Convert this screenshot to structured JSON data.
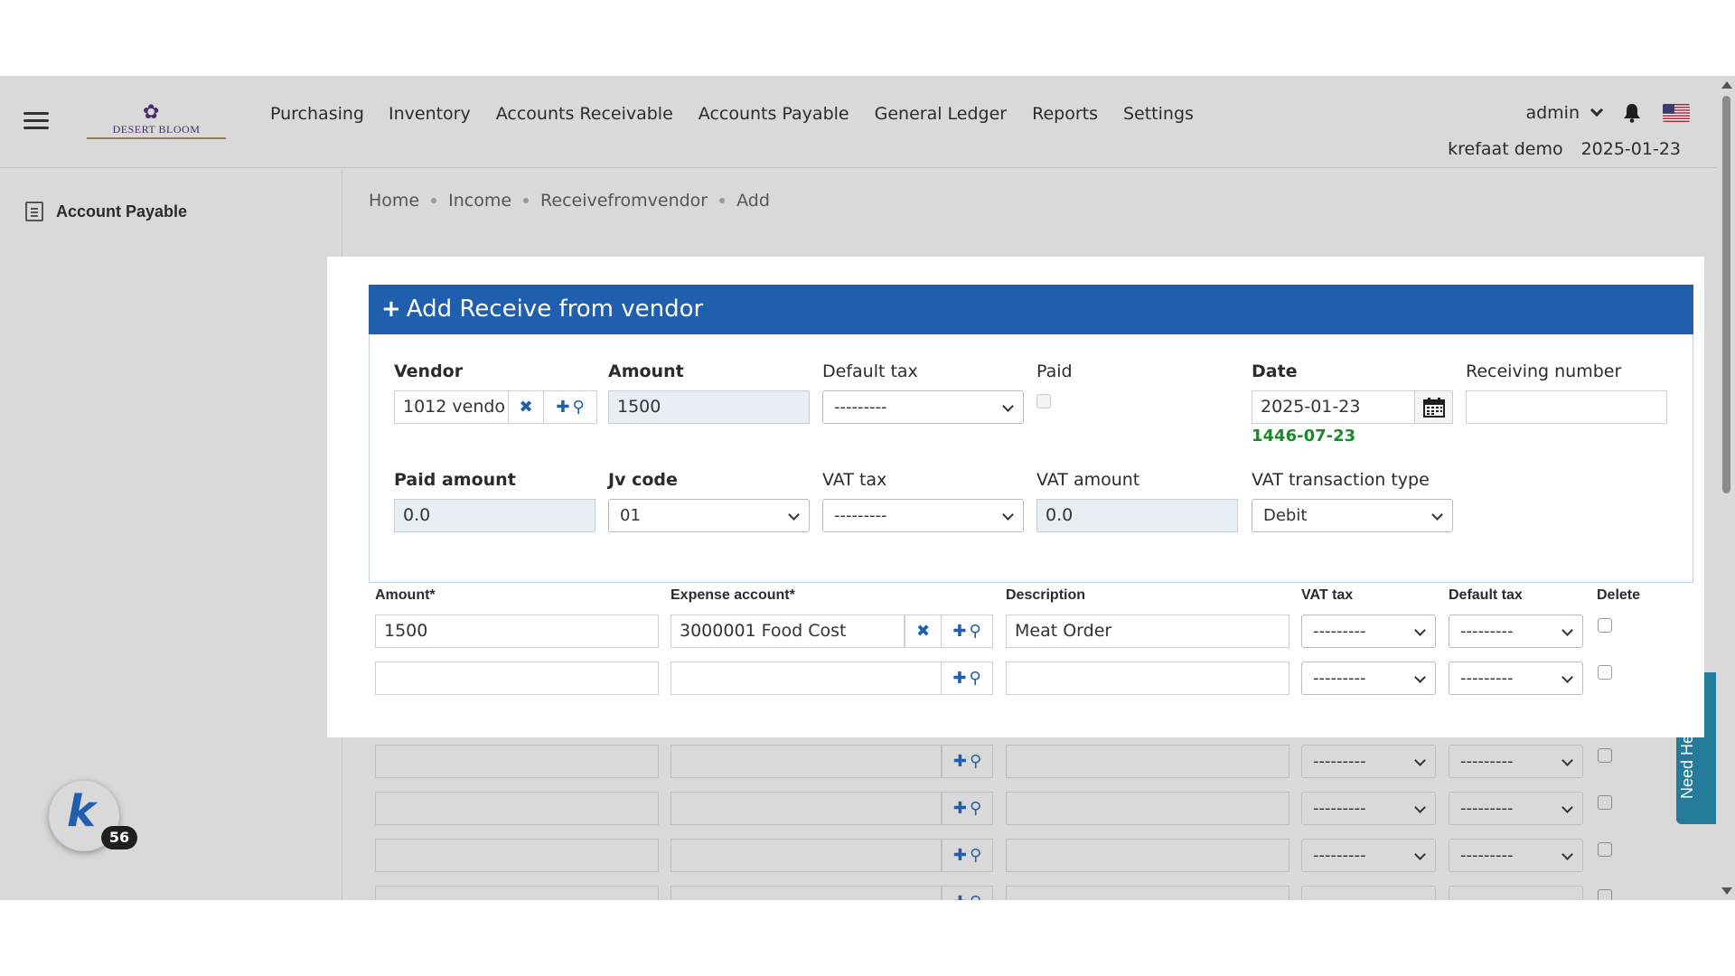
{
  "header": {
    "logo_text": "DESERT BLOOM",
    "nav": [
      "Purchasing",
      "Inventory",
      "Accounts Receivable",
      "Accounts Payable",
      "General Ledger",
      "Reports",
      "Settings"
    ],
    "user": "admin",
    "company": "krefaat demo",
    "date": "2025-01-23",
    "icons": {
      "menu": "hamburger-icon",
      "notifications": "bell-icon",
      "language": "us-flag-icon"
    }
  },
  "sidebar": {
    "items": [
      {
        "label": "Account Payable",
        "icon": "clipboard-icon"
      }
    ]
  },
  "breadcrumb": [
    "Home",
    "Income",
    "Receivefromvendor",
    "Add"
  ],
  "form": {
    "title": "Add Receive from vendor",
    "title_icon": "plus-icon",
    "vendor_label": "Vendor",
    "vendor_value": "1012 vendo",
    "amount_label": "Amount",
    "amount_value": "1500",
    "default_tax_label": "Default tax",
    "default_tax_value": "---------",
    "paid_label": "Paid",
    "paid_checked": false,
    "date_label": "Date",
    "date_value": "2025-01-23",
    "hijri_date": "1446-07-23",
    "receiving_number_label": "Receiving number",
    "receiving_number_value": "",
    "paid_amount_label": "Paid amount",
    "paid_amount_value": "0.0",
    "jv_code_label": "Jv code",
    "jv_code_value": "01",
    "vat_tax_label": "VAT tax",
    "vat_tax_value": "---------",
    "vat_amount_label": "VAT amount",
    "vat_amount_value": "0.0",
    "vat_transaction_type_label": "VAT transaction type",
    "vat_transaction_type_value": "Debit",
    "accent_color": "#1f5fad",
    "hijri_color": "#1c8a2a"
  },
  "lines": {
    "headers": [
      "Amount*",
      "Expense account*",
      "Description",
      "VAT tax",
      "Default tax",
      "Delete"
    ],
    "rows": [
      {
        "amount": "1500",
        "account": "3000001 Food Cost",
        "description": "Meat Order",
        "vat_tax": "---------",
        "default_tax": "---------"
      },
      {
        "amount": "",
        "account": "",
        "description": "",
        "vat_tax": "---------",
        "default_tax": "---------"
      },
      {
        "amount": "",
        "account": "",
        "description": "",
        "vat_tax": "---------",
        "default_tax": "---------"
      },
      {
        "amount": "",
        "account": "",
        "description": "",
        "vat_tax": "---------",
        "default_tax": "---------"
      },
      {
        "amount": "",
        "account": "",
        "description": "",
        "vat_tax": "---------",
        "default_tax": "---------"
      },
      {
        "amount": "",
        "account": "",
        "description": "",
        "vat_tax": "---------",
        "default_tax": "---------"
      }
    ]
  },
  "widgets": {
    "need_help": "Need Help?",
    "badge_count": "56",
    "badge_letter": "k"
  }
}
